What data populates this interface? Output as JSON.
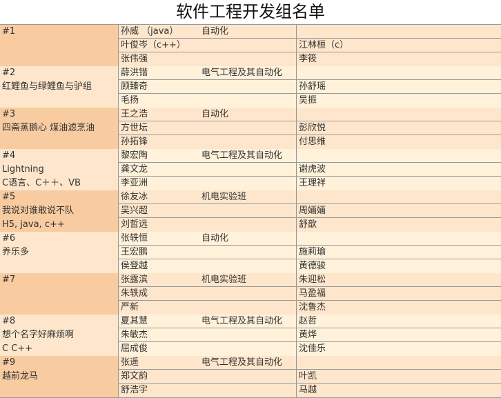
{
  "title": "软件工程开发组名单",
  "groups": [
    {
      "id": "#1",
      "lines": [
        "",
        ""
      ],
      "rows": [
        {
          "name": "孙威 （java）",
          "major": "自动化",
          "name2": ""
        },
        {
          "name": "叶俊岑（c++）",
          "major": "",
          "name2": "江林桓（c）"
        },
        {
          "name": "张伟强",
          "major": "",
          "name2": "李筱"
        }
      ]
    },
    {
      "id": "#2",
      "lines": [
        "红鲤鱼与绿鲤鱼与驴组",
        ""
      ],
      "rows": [
        {
          "name": "薛洪锴",
          "major": "电气工程及其自动化",
          "name2": ""
        },
        {
          "name": "顾臻奇",
          "major": "",
          "name2": "孙舒瑶"
        },
        {
          "name": "毛扬",
          "major": "",
          "name2": "吴振"
        }
      ]
    },
    {
      "id": "#3",
      "lines": [
        "四斋蒸鹅心 煤油滤烹油",
        ""
      ],
      "rows": [
        {
          "name": "王之浩",
          "major": "自动化",
          "name2": ""
        },
        {
          "name": "方世坛",
          "major": "",
          "name2": "彭欣悦"
        },
        {
          "name": "孙拓锋",
          "major": "",
          "name2": "付思维"
        }
      ]
    },
    {
      "id": "#4",
      "lines": [
        "Lightning",
        "C语言、C＋＋、VB"
      ],
      "rows": [
        {
          "name": "黎宏陶",
          "major": "电气工程及其自动化",
          "name2": ""
        },
        {
          "name": "龚文龙",
          "major": "",
          "name2": "谢虎波"
        },
        {
          "name": "李亚洲",
          "major": "",
          "name2": "王理祥"
        }
      ]
    },
    {
      "id": "#5",
      "lines": [
        "我说对谁敢说不队",
        "H5, java, c++"
      ],
      "rows": [
        {
          "name": "徐友冰",
          "major": "机电实验班",
          "name2": ""
        },
        {
          "name": "吴兴超",
          "major": "",
          "name2": "周婳婳"
        },
        {
          "name": "刘哲远",
          "major": "",
          "name2": "舒歆"
        }
      ]
    },
    {
      "id": "#6",
      "lines": [
        "养乐多",
        ""
      ],
      "rows": [
        {
          "name": "张轶恒",
          "major": "自动化",
          "name2": ""
        },
        {
          "name": "王宏鹏",
          "major": "",
          "name2": "施莉瑜"
        },
        {
          "name": "侯登越",
          "major": "",
          "name2": "黄德骏"
        }
      ]
    },
    {
      "id": "#7",
      "lines": [
        "",
        ""
      ],
      "rows": [
        {
          "name": "张露滨",
          "major": "机电实验班",
          "name2": "朱迎松"
        },
        {
          "name": "朱轶成",
          "major": "",
          "name2": "马盈福"
        },
        {
          "name": "严新",
          "major": "",
          "name2": "沈鲁杰"
        }
      ]
    },
    {
      "id": "#8",
      "lines": [
        "想个名字好麻烦啊",
        "C C++"
      ],
      "rows": [
        {
          "name": "夏其慧",
          "major": "电气工程及其自动化",
          "name2": "赵哲"
        },
        {
          "name": "朱敏杰",
          "major": "",
          "name2": "黄烨"
        },
        {
          "name": "屈成俊",
          "major": "",
          "name2": "沈佳乐"
        }
      ]
    },
    {
      "id": "#9",
      "lines": [
        "越前龙马",
        ""
      ],
      "rows": [
        {
          "name": "张遥",
          "major": "电气工程及其自动化",
          "name2": ""
        },
        {
          "name": "郑文韵",
          "major": "",
          "name2": "叶凯"
        },
        {
          "name": "舒浩宇",
          "major": "",
          "name2": "马越"
        }
      ]
    }
  ]
}
